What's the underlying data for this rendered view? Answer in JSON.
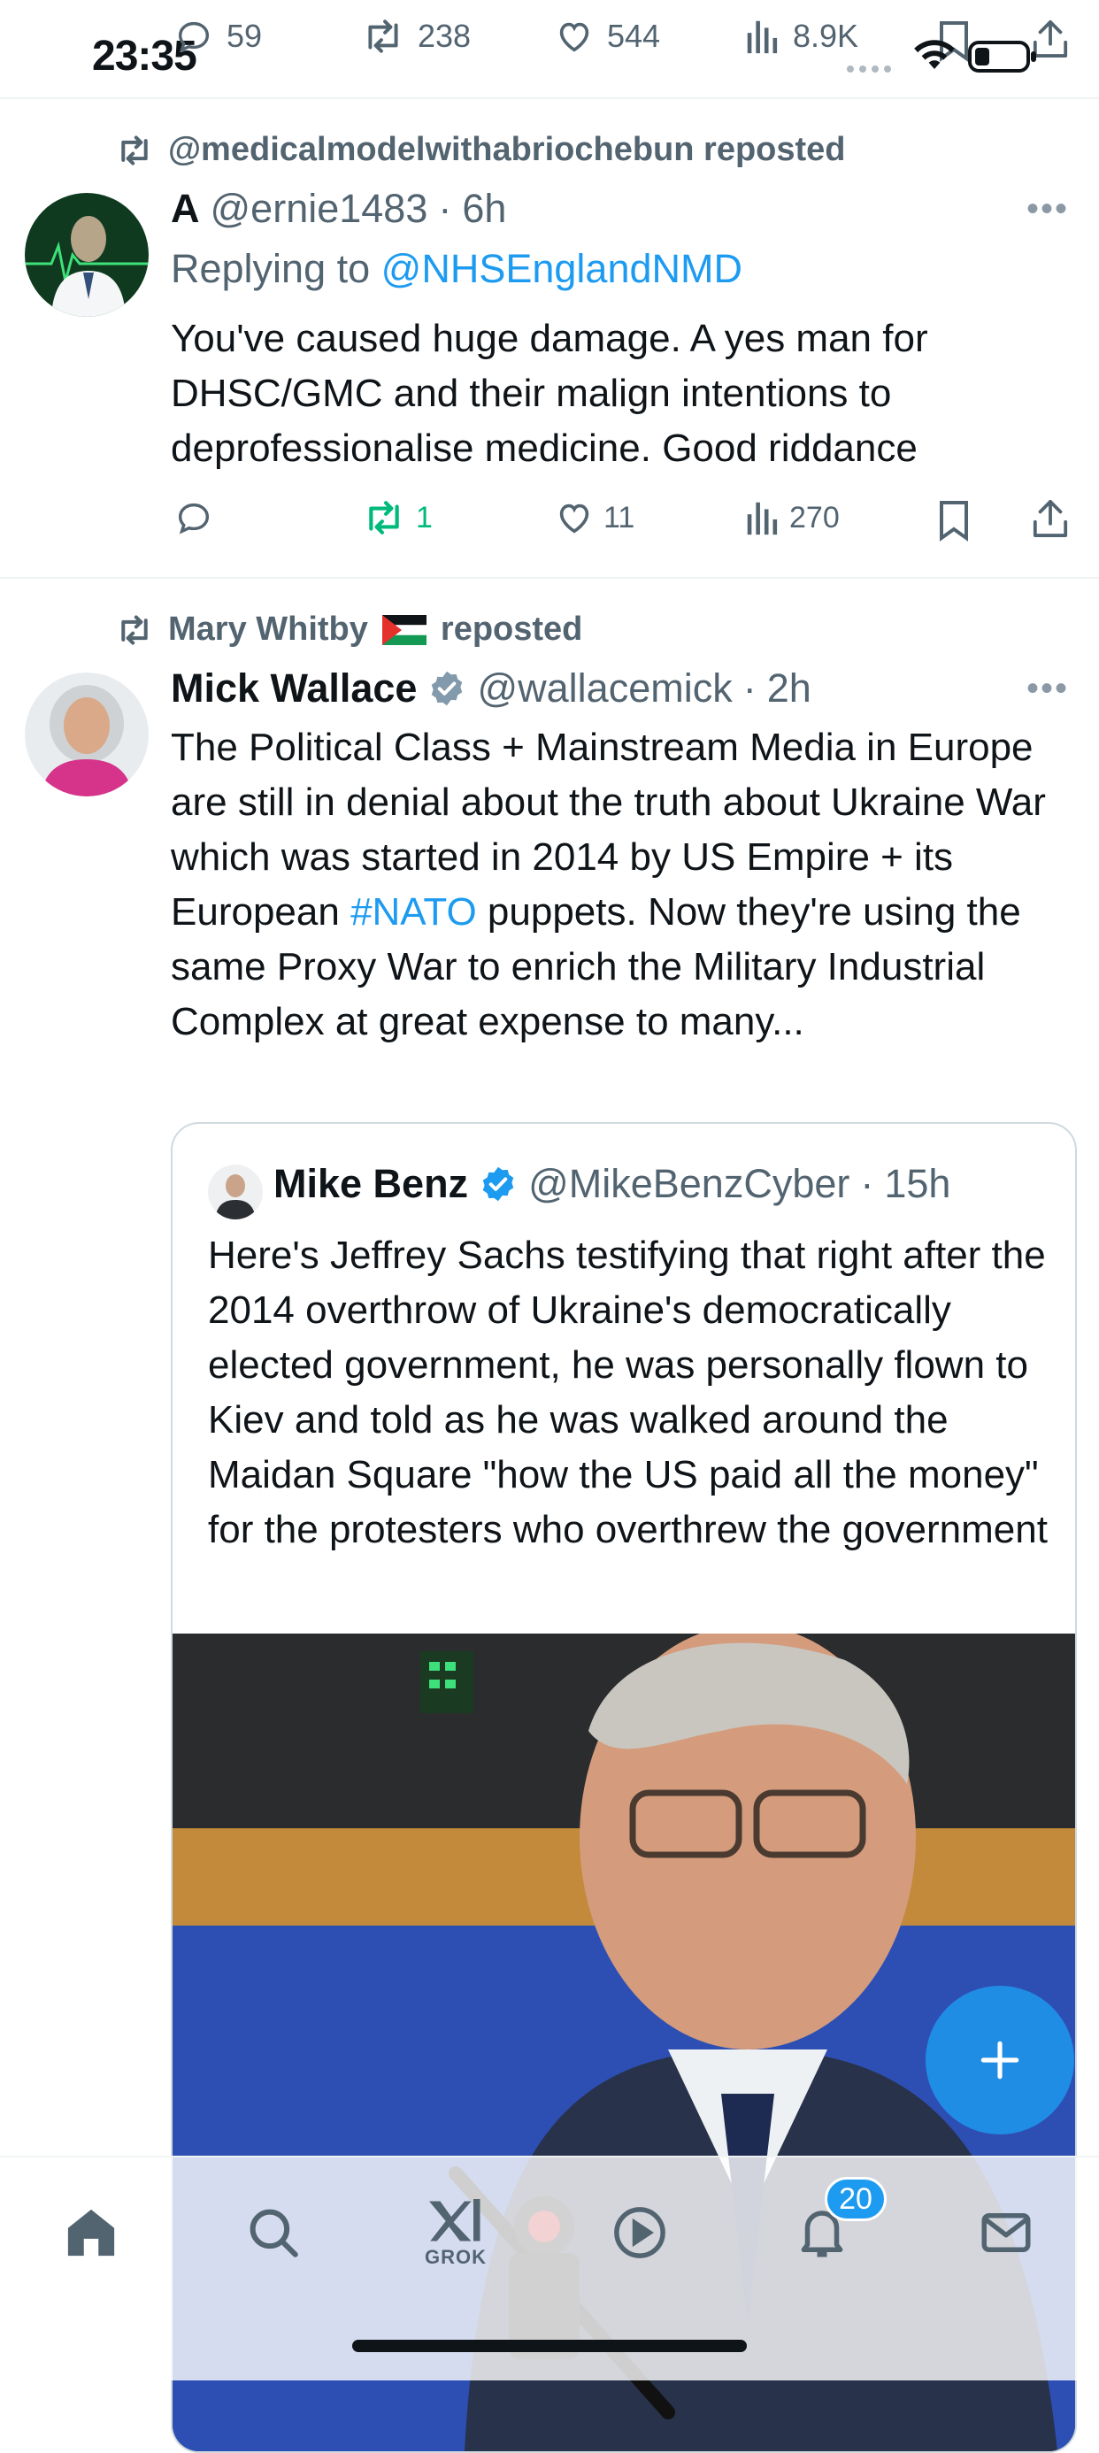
{
  "status_bar": {
    "time": "23:35"
  },
  "top_actions": {
    "replies": "59",
    "reposts": "238",
    "likes": "544",
    "views": "8.9K"
  },
  "tweet1": {
    "repost_label": "@medicalmodelwithabriochebun reposted",
    "name": "A",
    "handle": "@ernie1483",
    "time": "6h",
    "replying_prefix": "Replying to",
    "replying_to": "@NHSEnglandNMD",
    "text": "You've caused huge damage. A yes man for DHSC/GMC and their malign intentions to deprofessionalise medicine. Good riddance",
    "reposts": "1",
    "likes": "11",
    "views": "270"
  },
  "tweet2": {
    "repost_label_name": "Mary Whitby",
    "repost_label_suffix": "reposted",
    "name": "Mick Wallace",
    "handle": "@wallacemick",
    "time": "2h",
    "text_part1": "The Political Class + Mainstream Media in Europe are still in denial about the truth about Ukraine War which was started  in 2014 by US Empire + its European ",
    "hashtag": "#NATO",
    "text_part2": " puppets. Now they're using the same Proxy War to enrich the Military Industrial Complex at great expense to many...",
    "quote": {
      "name": "Mike Benz",
      "handle": "@MikeBenzCyber",
      "time": "15h",
      "text": "Here's Jeffrey Sachs testifying that right after the 2014 overthrow of Ukraine's democratically elected government, he was personally flown to Kiev and told as he was walked around the Maidan Square \"how the US paid all the money\" for the protesters who overthrew the government"
    }
  },
  "fab": {
    "icon": "plus-icon"
  },
  "bottom_nav": {
    "grok_label": "GROK",
    "notifications_badge": "20"
  },
  "colors": {
    "accent": "#1d9bf0",
    "repost_green": "#00ba7c",
    "muted": "#536471"
  }
}
